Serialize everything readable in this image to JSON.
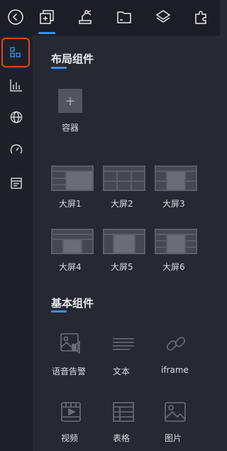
{
  "topbar": {
    "items": [
      {
        "icon": "back-circle-icon"
      },
      {
        "icon": "add-component-icon",
        "active": true
      },
      {
        "icon": "robot-arm-icon"
      },
      {
        "icon": "folder-icon"
      },
      {
        "icon": "layers-icon"
      },
      {
        "icon": "puzzle-icon"
      }
    ]
  },
  "sidebar": {
    "items": [
      {
        "icon": "layout-grid-icon",
        "active": true
      },
      {
        "icon": "bar-chart-icon"
      },
      {
        "icon": "globe-icon"
      },
      {
        "icon": "gauge-icon"
      },
      {
        "icon": "form-icon"
      }
    ]
  },
  "layout_section": {
    "title": "布局组件",
    "container": {
      "label": "容器"
    },
    "screens": [
      "大屏1",
      "大屏2",
      "大屏3",
      "大屏4",
      "大屏5",
      "大屏6"
    ]
  },
  "basic_section": {
    "title": "基本组件",
    "items": [
      {
        "label": "语音告警",
        "icon": "voice-alarm-icon"
      },
      {
        "label": "文本",
        "icon": "text-lines-icon"
      },
      {
        "label": "iframe",
        "icon": "link-icon"
      },
      {
        "label": "视频",
        "icon": "video-icon"
      },
      {
        "label": "表格",
        "icon": "table-icon"
      },
      {
        "label": "图片",
        "icon": "image-icon"
      }
    ]
  },
  "colors": {
    "accent": "#3a8ee6",
    "highlight_border": "#e0412b",
    "panel_bg": "#262932",
    "topbar_bg": "#1c1e25",
    "sidebar_bg": "#1f2128",
    "thumb": "#5b5e68"
  }
}
